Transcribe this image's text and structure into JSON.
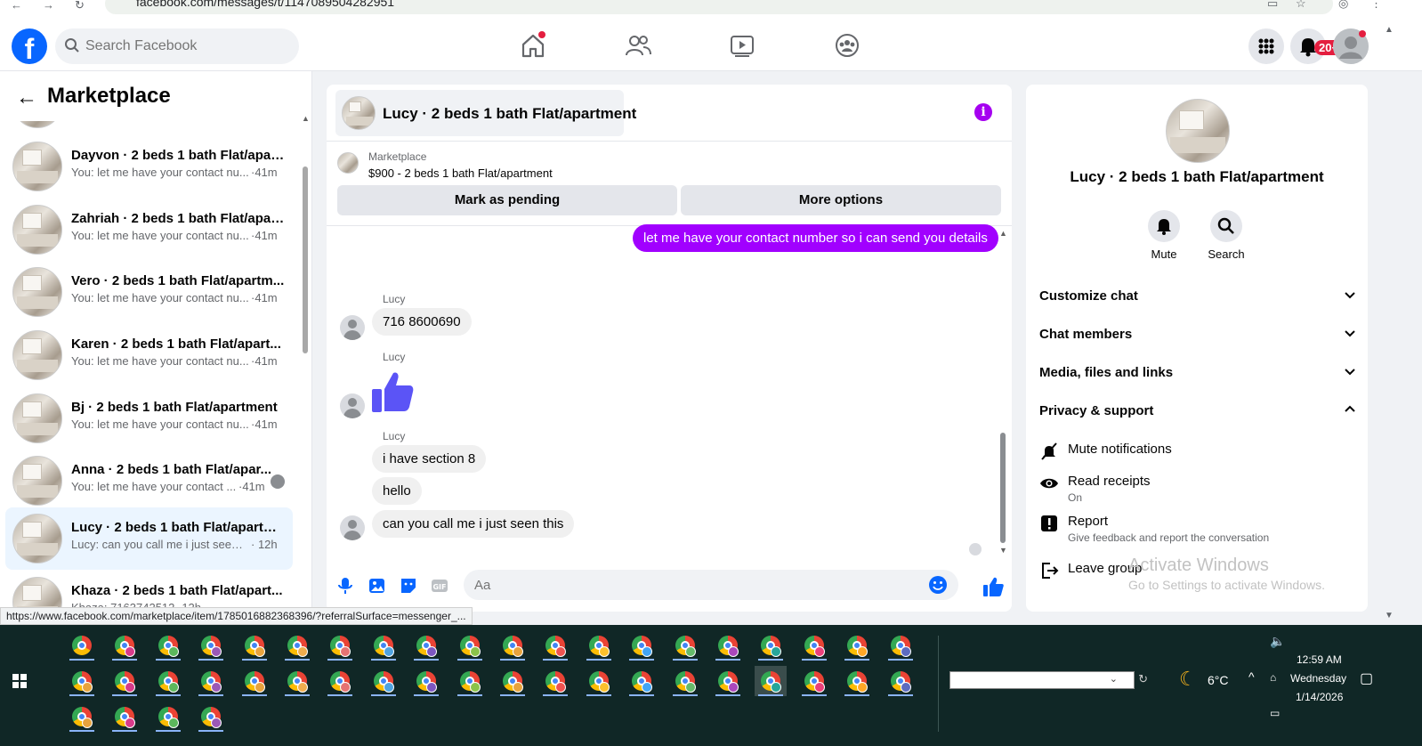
{
  "browser": {
    "url": "facebook.com/messages/t/1147089504282951"
  },
  "header": {
    "search_placeholder": "Search Facebook",
    "notifications_badge": "20+",
    "colors": {
      "brand": "#0866ff",
      "badge": "#e41e3f"
    }
  },
  "left": {
    "title": "Marketplace",
    "conversations": [
      {
        "name": "Dayvon · 2 beds 1 bath Flat/apar...",
        "snippet": "You: let me have your contact nu...",
        "time": "·41m",
        "active": false
      },
      {
        "name": "Zahriah · 2 beds 1 bath Flat/apar...",
        "snippet": "You: let me have your contact nu...",
        "time": "·41m",
        "active": false
      },
      {
        "name": "Vero · 2 beds 1 bath Flat/apartm...",
        "snippet": "You: let me have your contact nu...",
        "time": "·41m",
        "active": false
      },
      {
        "name": "Karen · 2 beds 1 bath Flat/apart...",
        "snippet": "You: let me have your contact nu...",
        "time": "·41m",
        "active": false
      },
      {
        "name": "Bj · 2 beds 1 bath Flat/apartment",
        "snippet": "You: let me have your contact nu...",
        "time": "·41m",
        "active": false
      },
      {
        "name": "Anna · 2 beds 1 bath Flat/apar...",
        "snippet": "You: let me have your contact ...",
        "time": "·41m",
        "active": false
      },
      {
        "name": "Lucy · 2 beds 1 bath Flat/apartm...",
        "snippet": "Lucy: can you call me i just seen t...",
        "time": "· 12h",
        "active": true
      },
      {
        "name": "Khaza · 2 beds 1 bath Flat/apart...",
        "snippet": "Khaza: 7163742512 ·12h",
        "time": "",
        "active": false
      }
    ],
    "status_url": "https://www.facebook.com/marketplace/item/1785016882368396/?referralSurface=messenger_..."
  },
  "chat": {
    "title": "Lucy · 2 beds 1 bath Flat/apartment",
    "listing_source": "Marketplace",
    "listing_price": "$900 - 2 beds 1 bath Flat/apartment",
    "mark_pending_label": "Mark as pending",
    "more_options_label": "More options",
    "outgoing_message": "let me have your contact number so i can send you details",
    "sender_name": "Lucy",
    "msg_phone": "716 8600690",
    "msg_section8": "i have  section 8",
    "msg_hello": "hello",
    "msg_call": "can you  call me  i just  seen this",
    "composer_placeholder": "Aa",
    "accent_color": "#a100ff"
  },
  "right": {
    "title": "Lucy · 2 beds 1 bath Flat/apartment",
    "mute_label": "Mute",
    "search_label": "Search",
    "sections": {
      "customize": "Customize chat",
      "members": "Chat members",
      "media": "Media, files and links",
      "privacy": "Privacy & support"
    },
    "items": {
      "mute_notifications": "Mute notifications",
      "read_receipts": "Read receipts",
      "read_receipts_status": "On",
      "report": "Report",
      "report_sub": "Give feedback and report the conversation",
      "leave_group": "Leave group"
    },
    "watermark_title": "Activate Windows",
    "watermark_sub": "Go to Settings to activate Windows."
  },
  "taskbar": {
    "temperature": "6°C",
    "time": "12:59 AM",
    "day": "Wednesday",
    "date": "1/14/2026"
  }
}
